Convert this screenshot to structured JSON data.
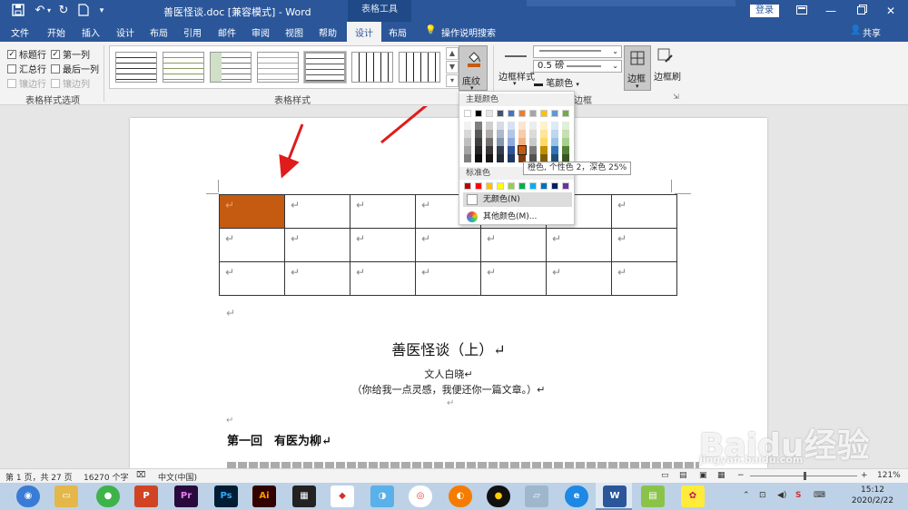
{
  "titlebar": {
    "doc_title": "善医怪谈.doc [兼容模式] - Word",
    "context_tools": "表格工具",
    "login": "登录"
  },
  "tabs": [
    "文件",
    "开始",
    "插入",
    "设计",
    "布局",
    "引用",
    "邮件",
    "审阅",
    "视图",
    "帮助",
    "设计",
    "布局"
  ],
  "tell_me": "操作说明搜索",
  "share": "共享",
  "style_options": {
    "items": [
      {
        "label": "标题行",
        "checked": true,
        "disabled": false
      },
      {
        "label": "第一列",
        "checked": true,
        "disabled": false
      },
      {
        "label": "汇总行",
        "checked": false,
        "disabled": false
      },
      {
        "label": "最后一列",
        "checked": false,
        "disabled": false
      },
      {
        "label": "镶边行",
        "checked": false,
        "disabled": true
      },
      {
        "label": "镶边列",
        "checked": false,
        "disabled": true
      }
    ],
    "group_label": "表格样式选项"
  },
  "table_styles": {
    "group_label": "表格样式"
  },
  "shading_label": "底纹",
  "borders": {
    "style_label": "边框样式",
    "weight": "0.5 磅",
    "pen_color": "笔颜色",
    "border_label": "边框",
    "painter_label": "边框刷",
    "group_label": "边框"
  },
  "color_menu": {
    "theme_header": "主题颜色",
    "standard_header": "标准色",
    "no_color": "无颜色(N)",
    "more_colors": "其他颜色(M)...",
    "tooltip": "橙色, 个性色 2，深色 25%",
    "theme_top": [
      "#ffffff",
      "#000000",
      "#e7e6e6",
      "#44546a",
      "#4472c4",
      "#ed7d31",
      "#a5a5a5",
      "#ffc000",
      "#5b9bd5",
      "#70ad47"
    ],
    "theme_shades": [
      [
        "#f2f2f2",
        "#7f7f7f",
        "#d0cece",
        "#d6dce4",
        "#d9e2f3",
        "#fbe5d5",
        "#ededed",
        "#fff2cc",
        "#deeaf6",
        "#e2efd9"
      ],
      [
        "#d8d8d8",
        "#595959",
        "#aeabab",
        "#adb9ca",
        "#b4c6e7",
        "#f7cbac",
        "#dbdbdb",
        "#fee599",
        "#bdd7ee",
        "#c5e0b3"
      ],
      [
        "#bfbfbf",
        "#3f3f3f",
        "#757070",
        "#8496b0",
        "#8eaadb",
        "#f4b183",
        "#c9c9c9",
        "#ffd966",
        "#9cc3e5",
        "#a8d08d"
      ],
      [
        "#a5a5a5",
        "#262626",
        "#3a3838",
        "#323e4f",
        "#2f5496",
        "#c55a11",
        "#7b7b7b",
        "#bf9000",
        "#2e75b5",
        "#538135"
      ],
      [
        "#7f7f7f",
        "#0c0c0c",
        "#171616",
        "#222a35",
        "#1f3864",
        "#833c0b",
        "#525252",
        "#7f6000",
        "#1e4d78",
        "#375623"
      ]
    ],
    "standard": [
      "#c00000",
      "#ff0000",
      "#ffc000",
      "#ffff00",
      "#92d050",
      "#00b050",
      "#00b0f0",
      "#0070c0",
      "#002060",
      "#7030a0"
    ]
  },
  "document": {
    "para_mark": "↵",
    "table": {
      "rows": 3,
      "cols": 7,
      "shaded_cell_color": "#c55a11"
    },
    "title": "善医怪谈（上）↵",
    "author": "文人白晓↵",
    "subtitle": "（你给我一点灵感，我便还你一篇文章。）↵",
    "chapter": "第一回　有医为柳↵"
  },
  "statusbar": {
    "page": "第 1 页，共 27 页",
    "words": "16270 个字",
    "lang": "中文(中国)",
    "zoom": "121%"
  },
  "taskbar": {
    "time": "15:12",
    "date": "2020/2/22",
    "apps": [
      "Pr",
      "Ps",
      "Ai"
    ]
  },
  "watermark": {
    "brand": "Baidu经验",
    "url": "jingyan.baidu.com"
  }
}
